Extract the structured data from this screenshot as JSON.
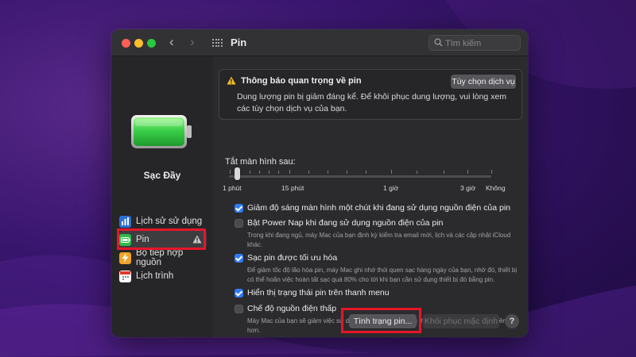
{
  "window": {
    "title": "Pin",
    "search_placeholder": "Tìm kiếm"
  },
  "sidebar": {
    "battery_status": "Sạc Đầy",
    "items": [
      {
        "label": "Lịch sử sử dụng",
        "icon": "bar-chart-icon"
      },
      {
        "label": "Pin",
        "icon": "battery-icon",
        "selected": true,
        "warning": true
      },
      {
        "label": "Bộ tiếp hợp nguồn",
        "icon": "lightning-icon"
      },
      {
        "label": "Lịch trình",
        "icon": "calendar-icon"
      }
    ]
  },
  "notice": {
    "title": "Thông báo quan trọng về pin",
    "text": "Dung lượng pin bị giảm đáng kể. Để khôi phục dung lượng, vui lòng xem các tùy chọn dịch vụ của bạn.",
    "button": "Tùy chọn dịch vụ"
  },
  "slider": {
    "label": "Tắt màn hình sau:",
    "ticks": [
      "1 phút",
      "15 phút",
      "1 giờ",
      "3 giờ",
      "Không"
    ],
    "value": "1 phút"
  },
  "options": [
    {
      "label": "Giảm độ sáng màn hình một chút khi đang sử dụng nguồn điện của pin",
      "checked": true,
      "desc": ""
    },
    {
      "label": "Bật Power Nap khi đang sử dụng nguồn điện của pin",
      "checked": false,
      "desc": "Trong khi đang ngủ, máy Mac của bạn định kỳ kiểm tra email mới, lịch và các cập nhật iCloud khác."
    },
    {
      "label": "Sạc pin được tối ưu hóa",
      "checked": true,
      "desc": "Để giảm tốc độ lão hóa pin, máy Mac ghi nhớ thói quen sạc hàng ngày của bạn, nhờ đó, thiết bị có thể hoãn việc hoàn tất sạc quá 80% cho tới khi bạn cần sử dụng thiết bị đó bằng pin."
    },
    {
      "label": "Hiển thị trạng thái pin trên thanh menu",
      "checked": true,
      "desc": ""
    },
    {
      "label": "Chế độ nguồn điện thấp",
      "checked": false,
      "desc": "Máy Mac của bạn sẽ giảm việc sử dụng năng lượng để tăng thời lượng pin và hoạt động êm ái hơn."
    }
  ],
  "footer": {
    "health_button": "Tình trạng pin...",
    "restore_button": "Khôi phục mặc định",
    "help": "?"
  },
  "colors": {
    "accent": "#2f7bf5",
    "highlight": "#e5162a",
    "battery_green": "#3bd04a"
  }
}
